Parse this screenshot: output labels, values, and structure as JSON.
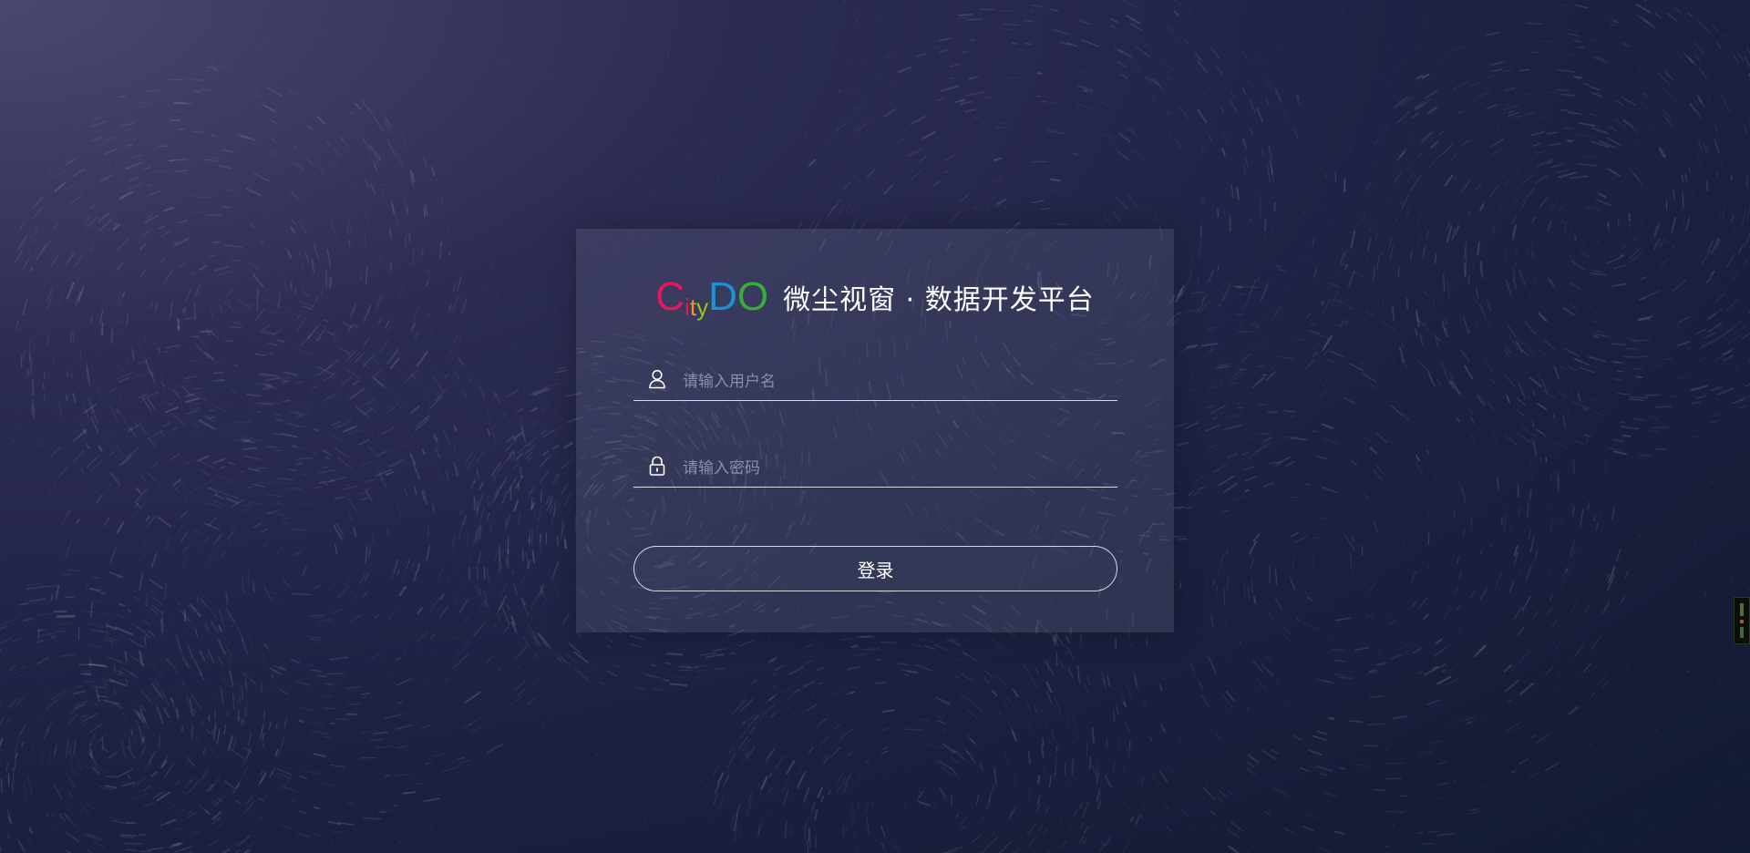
{
  "app": {
    "logo": {
      "letters": [
        {
          "char": "C",
          "color": "#e5185f"
        },
        {
          "char": "i",
          "color": "#e5185f"
        },
        {
          "char": "t",
          "color": "#f29a18"
        },
        {
          "char": "y",
          "color": "#9bc31c"
        },
        {
          "char": "D",
          "color": "#1e90d6"
        },
        {
          "char": "O",
          "color": "#3aac3a"
        }
      ]
    },
    "title": "微尘视窗 · 数据开发平台"
  },
  "form": {
    "username_placeholder": "请输入用户名",
    "password_placeholder": "请输入密码",
    "login_label": "登录"
  },
  "icons": {
    "username": "user-icon",
    "password": "lock-icon"
  },
  "colors": {
    "background": "#1d2142",
    "card": "rgba(120,125,150,0.22)",
    "text": "#ffffff",
    "placeholder": "#8a90a8"
  }
}
